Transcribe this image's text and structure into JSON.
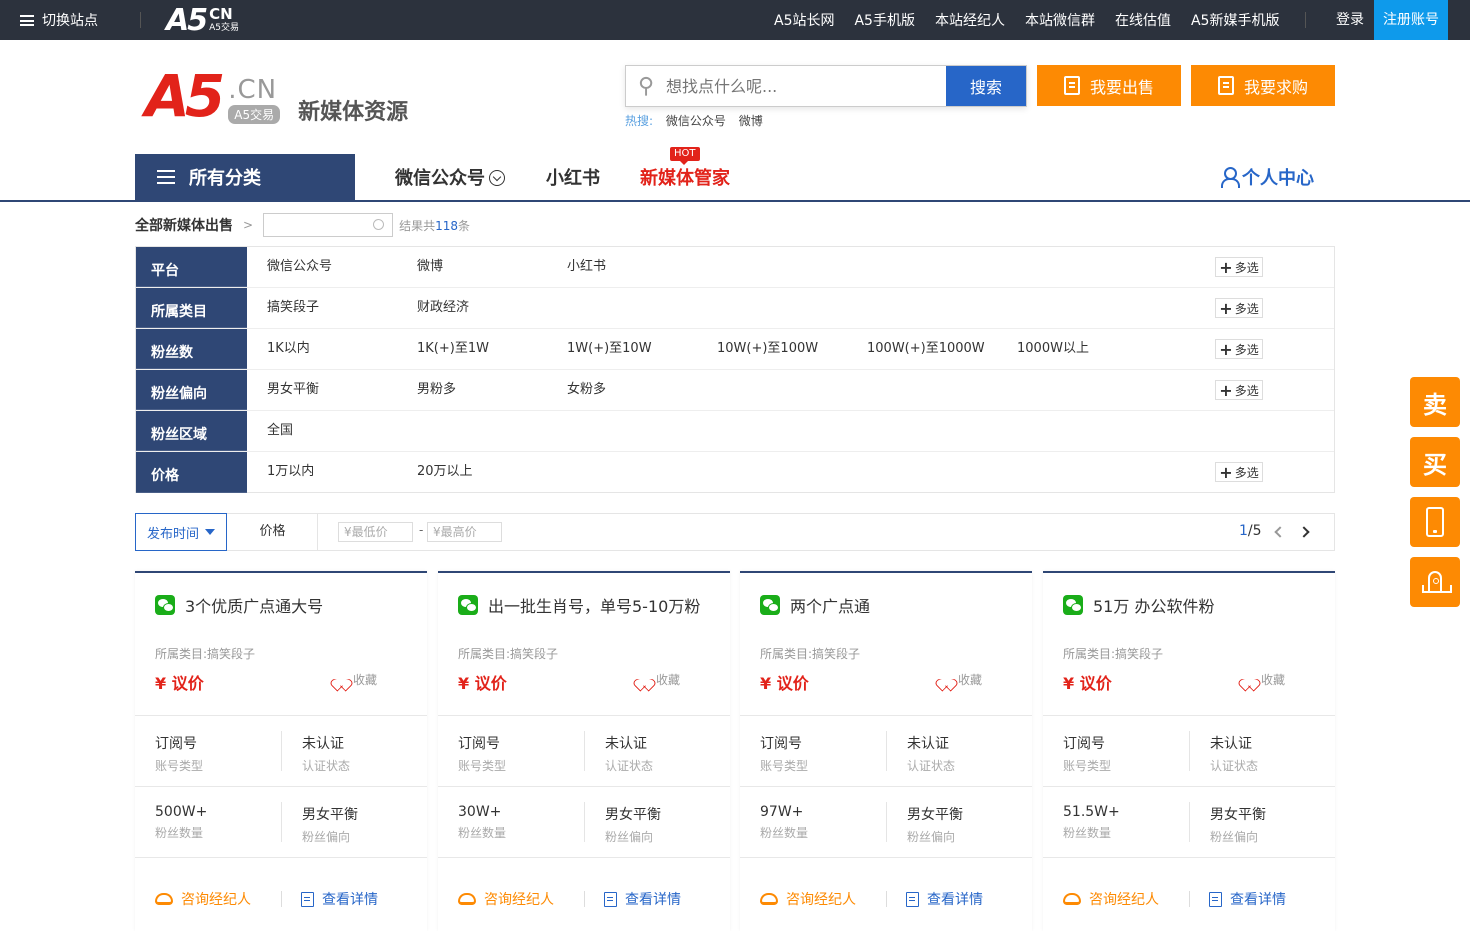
{
  "topbar": {
    "switch_label": "切换站点",
    "logo": {
      "main": "A5",
      "cn": "CN",
      "sub": "A5交易"
    },
    "nav": [
      "A5站长网",
      "A5手机版",
      "本站经纪人",
      "本站微信群",
      "在线估值",
      "A5新媒手机版"
    ],
    "login": "登录",
    "register": "注册账号"
  },
  "header": {
    "logo": {
      "main": "A5",
      "cn": ".CN",
      "sub": "A5交易",
      "site_name": "新媒体资源"
    },
    "search": {
      "placeholder": "想找点什么呢...",
      "button": "搜索"
    },
    "hot": {
      "label": "热搜:",
      "items": [
        "微信公众号",
        "微博"
      ]
    },
    "sell_button": "我要出售",
    "buy_button": "我要求购"
  },
  "nav": {
    "all_categories": "所有分类",
    "items": [
      "微信公众号",
      "小红书",
      "新媒体管家"
    ],
    "hot_badge": "HOT",
    "user_center": "个人中心"
  },
  "breadcrumb": {
    "title": "全部新媒体出售",
    "sep": ">",
    "result_prefix": "结果共",
    "result_count": "118",
    "result_suffix": "条"
  },
  "filters": [
    {
      "label": "平台",
      "options": [
        "微信公众号",
        "微博",
        "小红书"
      ],
      "multi": true
    },
    {
      "label": "所属类目",
      "options": [
        "搞笑段子",
        "财政经济"
      ],
      "multi": true
    },
    {
      "label": "粉丝数",
      "options": [
        "1K以内",
        "1K(+)至1W",
        "1W(+)至10W",
        "10W(+)至100W",
        "100W(+)至1000W",
        "1000W以上"
      ],
      "multi": true
    },
    {
      "label": "粉丝偏向",
      "options": [
        "男女平衡",
        "男粉多",
        "女粉多"
      ],
      "multi": true
    },
    {
      "label": "粉丝区域",
      "options": [
        "全国"
      ],
      "multi": false
    },
    {
      "label": "价格",
      "options": [
        "1万以内",
        "20万以上"
      ],
      "multi": true
    }
  ],
  "multi_label": "多选",
  "sort": {
    "publish_time": "发布时间",
    "price": "价格",
    "min_placeholder": "¥最低价",
    "max_placeholder": "¥最高价",
    "dash": "-",
    "page_current": "1",
    "page_total": "/5"
  },
  "cards": [
    {
      "title": "3个优质广点通大号",
      "category": "所属类目:搞笑段子",
      "price": "¥ 议价",
      "fav": "收藏",
      "type": "订阅号",
      "type_label": "账号类型",
      "auth": "未认证",
      "auth_label": "认证状态",
      "fans": "500W+",
      "fans_label": "粉丝数量",
      "bias": "男女平衡",
      "bias_label": "粉丝偏向",
      "consult": "咨询经纪人",
      "detail": "查看详情"
    },
    {
      "title": "出一批生肖号，单号5-10万粉",
      "category": "所属类目:搞笑段子",
      "price": "¥ 议价",
      "fav": "收藏",
      "type": "订阅号",
      "type_label": "账号类型",
      "auth": "未认证",
      "auth_label": "认证状态",
      "fans": "30W+",
      "fans_label": "粉丝数量",
      "bias": "男女平衡",
      "bias_label": "粉丝偏向",
      "consult": "咨询经纪人",
      "detail": "查看详情"
    },
    {
      "title": "两个广点通",
      "category": "所属类目:搞笑段子",
      "price": "¥ 议价",
      "fav": "收藏",
      "type": "订阅号",
      "type_label": "账号类型",
      "auth": "未认证",
      "auth_label": "认证状态",
      "fans": "97W+",
      "fans_label": "粉丝数量",
      "bias": "男女平衡",
      "bias_label": "粉丝偏向",
      "consult": "咨询经纪人",
      "detail": "查看详情"
    },
    {
      "title": "51万 办公软件粉",
      "category": "所属类目:搞笑段子",
      "price": "¥ 议价",
      "fav": "收藏",
      "type": "订阅号",
      "type_label": "账号类型",
      "auth": "未认证",
      "auth_label": "认证状态",
      "fans": "51.5W+",
      "fans_label": "粉丝数量",
      "bias": "男女平衡",
      "bias_label": "粉丝偏向",
      "consult": "咨询经纪人",
      "detail": "查看详情"
    }
  ],
  "side": {
    "sell": "卖",
    "buy": "买",
    "phone_icon": "phone-icon",
    "top_icon": "rocket-icon"
  },
  "colors": {
    "navy": "#2f4775",
    "orange": "#fd8a03",
    "blue": "#2766c8",
    "red": "#e2231a",
    "topbar": "#2c323d"
  }
}
